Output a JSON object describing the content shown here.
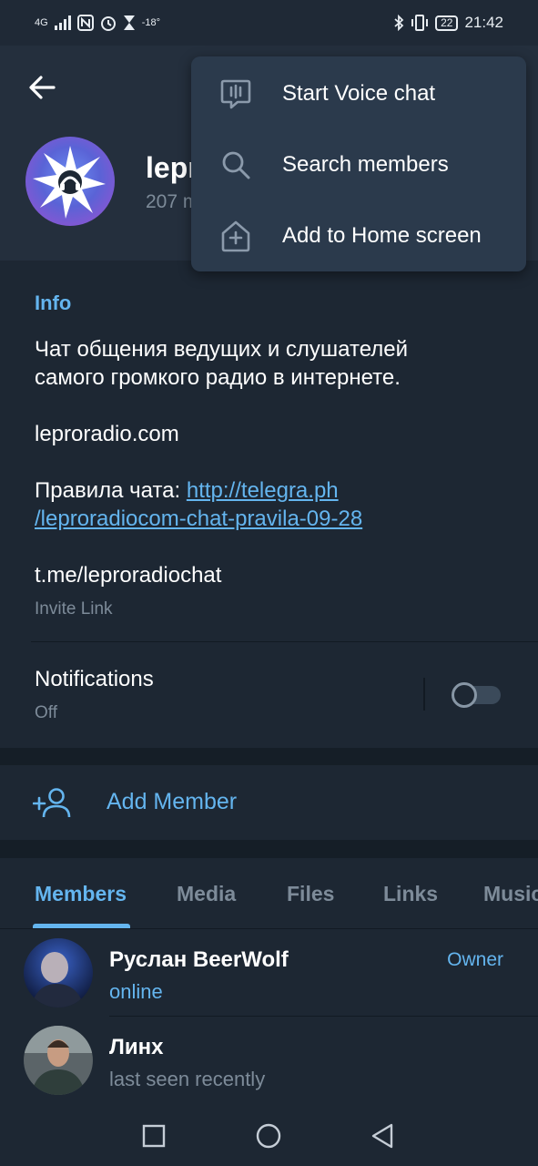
{
  "status_bar": {
    "network": "4G",
    "temperature": "-18°",
    "battery": "22",
    "time": "21:42"
  },
  "header": {
    "chat_title": "lepr",
    "chat_subtitle": "207 m"
  },
  "menu": {
    "items": [
      {
        "label": "Start Voice chat",
        "icon": "voice-chat-icon"
      },
      {
        "label": "Search members",
        "icon": "search-icon"
      },
      {
        "label": "Add to Home screen",
        "icon": "add-home-icon"
      }
    ]
  },
  "info": {
    "title": "Info",
    "desc_line1": "Чат общения ведущих и слушателей",
    "desc_line2": "самого громкого радио в интернете.",
    "site": "leproradio.com",
    "rules_prefix": "Правила чата: ",
    "rules_link_1": "http://telegra.ph",
    "rules_link_2": "/leproradiocom-chat-pravila-09-28",
    "invite_link": "t.me/leproradiochat",
    "invite_label": "Invite Link"
  },
  "notifications": {
    "label": "Notifications",
    "status": "Off"
  },
  "add_member": {
    "label": "Add Member"
  },
  "tabs": [
    {
      "label": "Members",
      "active": true
    },
    {
      "label": "Media",
      "active": false
    },
    {
      "label": "Files",
      "active": false
    },
    {
      "label": "Links",
      "active": false
    },
    {
      "label": "Music",
      "active": false
    }
  ],
  "members": [
    {
      "name": "Руслан BeerWolf",
      "status": "online",
      "role": "Owner"
    },
    {
      "name": "Линх",
      "status": "last seen recently",
      "role": ""
    }
  ],
  "colors": {
    "accent": "#64b5ef",
    "background": "#1d2733",
    "header": "#242f3d",
    "menu": "#2b3a4c",
    "muted": "#7d8b99"
  }
}
